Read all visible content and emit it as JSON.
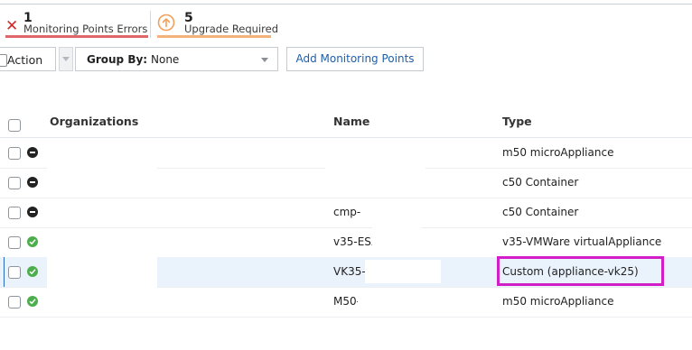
{
  "summary": {
    "errors": {
      "count": "1",
      "label": "Monitoring Points Errors",
      "icon": "x-icon",
      "color": "#d02b2b"
    },
    "upgrade": {
      "count": "5",
      "label": "Upgrade Required",
      "icon": "arrow-up-circle-icon",
      "color": "#f0a05a"
    }
  },
  "toolbar": {
    "action_label": "Action",
    "group_by_label": "Group By:",
    "group_by_value": "None",
    "add_button_label": "Add Monitoring Points"
  },
  "table": {
    "columns": [
      "Organizations",
      "Name",
      "Type"
    ],
    "rows": [
      {
        "status": "offline",
        "name": "",
        "type": "m50 microAppliance"
      },
      {
        "status": "offline",
        "name": "",
        "type": "c50 Container"
      },
      {
        "status": "offline",
        "name": "cmp-",
        "type": "c50 Container"
      },
      {
        "status": "online",
        "name": "v35-ESXi-",
        "type": "v35-VMWare virtualAppliance"
      },
      {
        "status": "online",
        "name": "VK35-",
        "type": "Custom (appliance-vk25)",
        "selected": true
      },
      {
        "status": "online",
        "name": "M50-",
        "type": "m50 microAppliance"
      }
    ]
  },
  "colors": {
    "highlight": "#d21ec6",
    "selected_row": "#eaf3fc",
    "link": "#1f5fa8"
  }
}
